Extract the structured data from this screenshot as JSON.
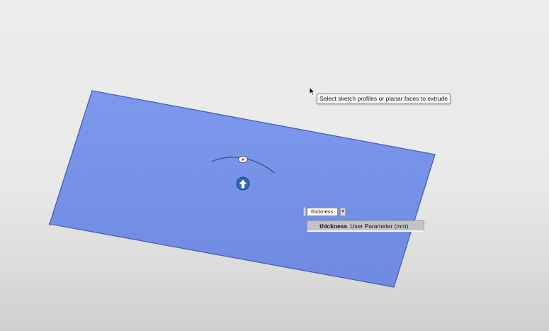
{
  "viewport": {
    "face_color": "#7b98ec",
    "edge_color": "#4a5fae"
  },
  "tooltip": {
    "text": "Select sketch profiles or planar faces to extrude"
  },
  "distance_input": {
    "value": "thickness",
    "dropdown_icon": "caret-down-icon"
  },
  "suggestion": {
    "name": "thickness",
    "description": "User Parameter (mm)"
  },
  "icons": {
    "cursor": "arrow-cursor-icon",
    "manipulator": "extrude-arrow-icon",
    "angle_handle": "angle-handle-icon"
  }
}
